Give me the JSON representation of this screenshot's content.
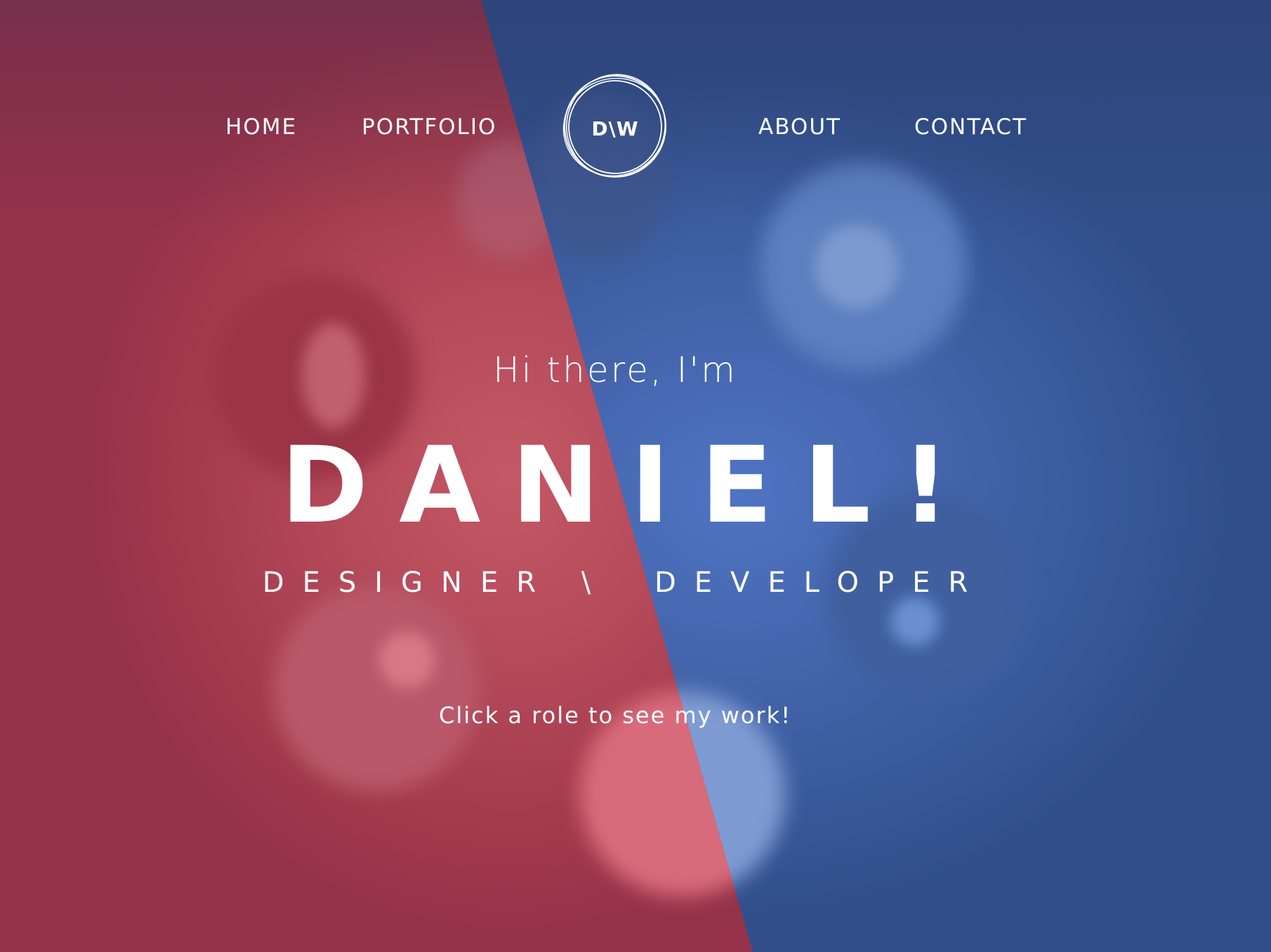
{
  "nav": {
    "home": "HOME",
    "portfolio": "PORTFOLIO",
    "about": "ABOUT",
    "contact": "CONTACT"
  },
  "logo": {
    "text": "D\\W"
  },
  "hero": {
    "greeting": "Hi there, I'm",
    "name": "DANIEL!",
    "role_designer": "DESIGNER",
    "role_separator": "\\",
    "role_developer": "DEVELOPER",
    "hint": "Click a role to see my work!"
  },
  "colors": {
    "designer_red": "#b44a5a",
    "developer_blue": "#4667b0",
    "text": "#ffffff"
  }
}
